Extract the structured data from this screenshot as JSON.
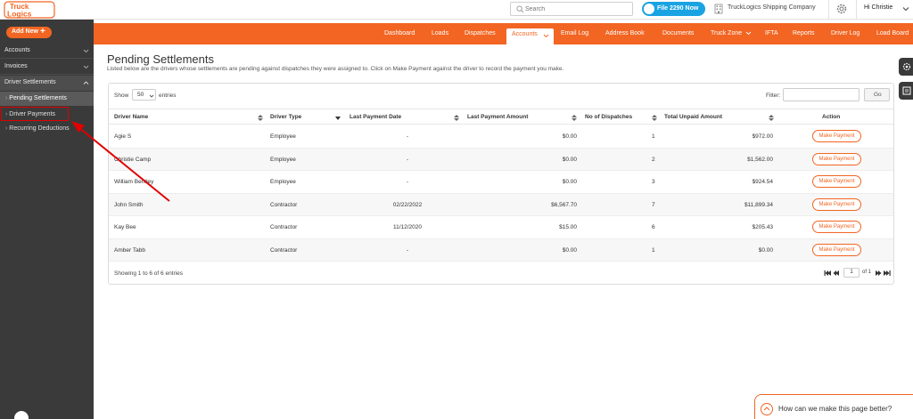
{
  "header": {
    "logo_text": "Truck Logics",
    "search_placeholder": "Search",
    "file_button": "File 2290 Now",
    "company": "TruckLogics Shipping Company",
    "greeting": "Hi Christie"
  },
  "sidebar": {
    "add_new": "Add New",
    "items": [
      {
        "label": "Accounts"
      },
      {
        "label": "Invoices"
      },
      {
        "label": "Driver Settlements"
      }
    ],
    "sub_items": [
      {
        "label": "Pending Settlements"
      },
      {
        "label": "Driver Payments"
      },
      {
        "label": "Recurring Deductions"
      }
    ]
  },
  "nav": {
    "items": [
      "Dashboard",
      "Loads",
      "Dispatches",
      "Accounts",
      "Email Log",
      "Address Book",
      "Documents",
      "Truck Zone",
      "IFTA",
      "Reports",
      "Driver Log",
      "Load Board"
    ],
    "active": "Accounts"
  },
  "page": {
    "title": "Pending Settlements",
    "subtitle": "Listed below are the drivers whose settlements are pending against dispatches they were assigned to. Click on Make Payment against the driver to record the payment you make."
  },
  "table_controls": {
    "show_label": "Show",
    "show_value": "50",
    "entries_label": "entries",
    "filter_label": "Filter:",
    "go_label": "Go"
  },
  "table": {
    "columns": [
      "Driver Name",
      "Driver Type",
      "Last Payment Date",
      "Last Payment Amount",
      "No of Dispatches",
      "Total Unpaid Amount",
      "Action"
    ],
    "rows": [
      {
        "name": "Agie S",
        "type": "Employee",
        "date": "-",
        "amount": "$0.00",
        "dispatches": "1",
        "unpaid": "$972.00",
        "action": "Make Payment"
      },
      {
        "name": "Christie Camp",
        "type": "Employee",
        "date": "-",
        "amount": "$0.00",
        "dispatches": "2",
        "unpaid": "$1,562.00",
        "action": "Make Payment"
      },
      {
        "name": "William Bentley",
        "type": "Employee",
        "date": "-",
        "amount": "$0.00",
        "dispatches": "3",
        "unpaid": "$924.54",
        "action": "Make Payment"
      },
      {
        "name": "John Smith",
        "type": "Contractor",
        "date": "02/22/2022",
        "amount": "$6,567.70",
        "dispatches": "7",
        "unpaid": "$11,899.34",
        "action": "Make Payment"
      },
      {
        "name": "Kay Bee",
        "type": "Contractor",
        "date": "11/12/2020",
        "amount": "$15.00",
        "dispatches": "6",
        "unpaid": "$205.43",
        "action": "Make Payment"
      },
      {
        "name": "Amber Tabb",
        "type": "Contractor",
        "date": "-",
        "amount": "$0.00",
        "dispatches": "1",
        "unpaid": "$0.00",
        "action": "Make Payment"
      }
    ],
    "showing": "Showing 1 to 6 of 6 entries",
    "page_value": "1",
    "page_of": "of 1"
  },
  "feedback": {
    "label": "How can we make this page better?"
  },
  "colors": {
    "brand_orange": "#f26522",
    "sidebar_dark": "#3a3a3a",
    "file_blue": "#1aa3e2",
    "annotation_red": "#e00000"
  }
}
